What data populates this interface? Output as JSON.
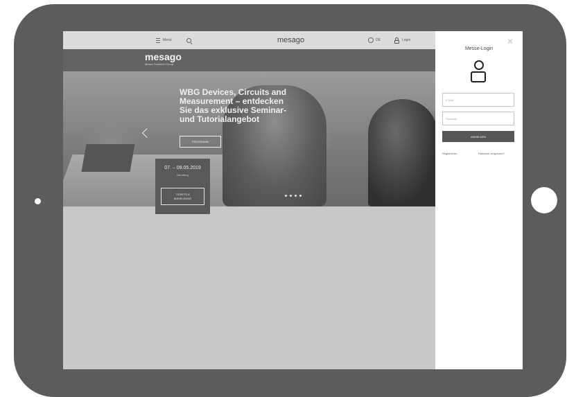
{
  "topbar": {
    "menu_label": "Menü",
    "brand": "mesago",
    "lang_label": "DE",
    "login_label": "Login"
  },
  "logo": {
    "name": "mesago",
    "subtitle": "Messe Frankfurt Group"
  },
  "hero": {
    "title": "WBG Devices, Circuits and Measurement – entdecken Sie das exklusive Seminar- und Tutorialangebot",
    "program_button": "PROGRAMM",
    "slide_count": 4
  },
  "event": {
    "date": "07. – 09.05.2019",
    "city": "Nürnberg",
    "tickets_line1": "TICKETS &",
    "tickets_line2": "ANMELDUNG"
  },
  "login_panel": {
    "title": "Messe-Login",
    "email_placeholder": "E-Mail",
    "password_placeholder": "Passwort",
    "submit": "ANMELDEN",
    "register_link": "Registrieren",
    "forgot_link": "Passwort vergessen?"
  }
}
